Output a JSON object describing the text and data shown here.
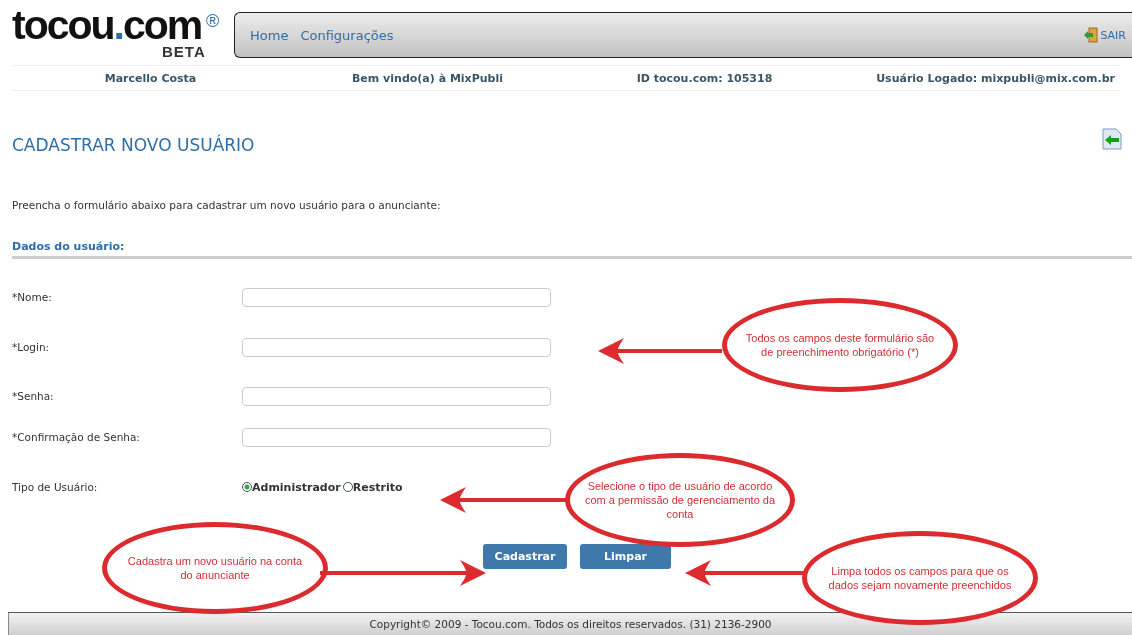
{
  "logo": {
    "text": "tocou",
    "dot": ".",
    "suffix": "com",
    "mark": "®",
    "sub": "BETA"
  },
  "nav": [
    {
      "label": "Home"
    },
    {
      "label": "Configurações"
    }
  ],
  "logout": "SAIR",
  "info": [
    "Marcello Costa",
    "Bem vindo(a) à MixPubli",
    "ID tocou.com: 105318",
    "Usuário Logado: mixpubli@mix.com.br"
  ],
  "title": "CADASTRAR NOVO USUÁRIO",
  "intro": "Preencha o formulário abaixo para cadastrar um novo usuário para o anunciante:",
  "section": "Dados do usuário:",
  "fields": [
    {
      "label": "*Nome:"
    },
    {
      "label": "*Login:"
    },
    {
      "label": "*Senha:"
    },
    {
      "label": "*Confirmação de Senha:"
    }
  ],
  "user_type": {
    "label": "Tipo de Usuário:",
    "options": [
      {
        "label": "Administrador",
        "selected": true
      },
      {
        "label": "Restrito",
        "selected": false
      }
    ]
  },
  "buttons": [
    "Cadastrar",
    "Limpar"
  ],
  "annotations": [
    {
      "text": "Todos os campos deste formulário são de preenchimento obrigatório (*)",
      "kind": "left"
    },
    {
      "text": "Selecione o tipo de usuário de acordo com a permissão de gerenciamento da conta",
      "kind": "left"
    },
    {
      "text": "Cadastra um novo usuário na conta do anunciante",
      "kind": "right"
    },
    {
      "text": "Limpa todos os campos para que os dados sejam novamente preenchidos",
      "kind": "left"
    }
  ],
  "footer": "Copyright© 2009 - Tocou.com. Todos os direitos reservados. (31) 2136-2900"
}
